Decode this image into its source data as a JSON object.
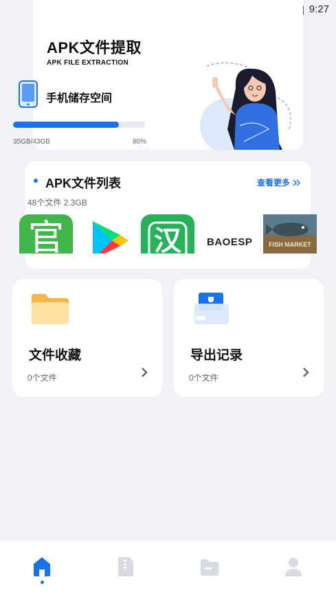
{
  "status_bar": {
    "time": "9:27"
  },
  "hero": {
    "title": "APK文件提取",
    "subtitle": "APK FILE EXTRACTION",
    "storage_label": "手机储存空间",
    "storage_used": "35GB/43GB",
    "storage_percent": "80%",
    "storage_fraction": 0.8
  },
  "apk_list": {
    "title": "APK文件列表",
    "more_label": "查看更多",
    "meta": "48个文件  2.3GB",
    "apps": [
      {
        "name": "guan-app-icon",
        "text": "官"
      },
      {
        "name": "google-play-icon",
        "text": ""
      },
      {
        "name": "han-app-icon",
        "text": "汉"
      },
      {
        "name": "baoesp-icon",
        "text": "BAOESP"
      },
      {
        "name": "fish-market-icon",
        "text": "FISH MARKET"
      }
    ]
  },
  "features": [
    {
      "title": "文件收藏",
      "count": "0个文件"
    },
    {
      "title": "导出记录",
      "count": "0个文件"
    }
  ],
  "colors": {
    "accent": "#1a73e8",
    "background": "#f1f2f6"
  }
}
